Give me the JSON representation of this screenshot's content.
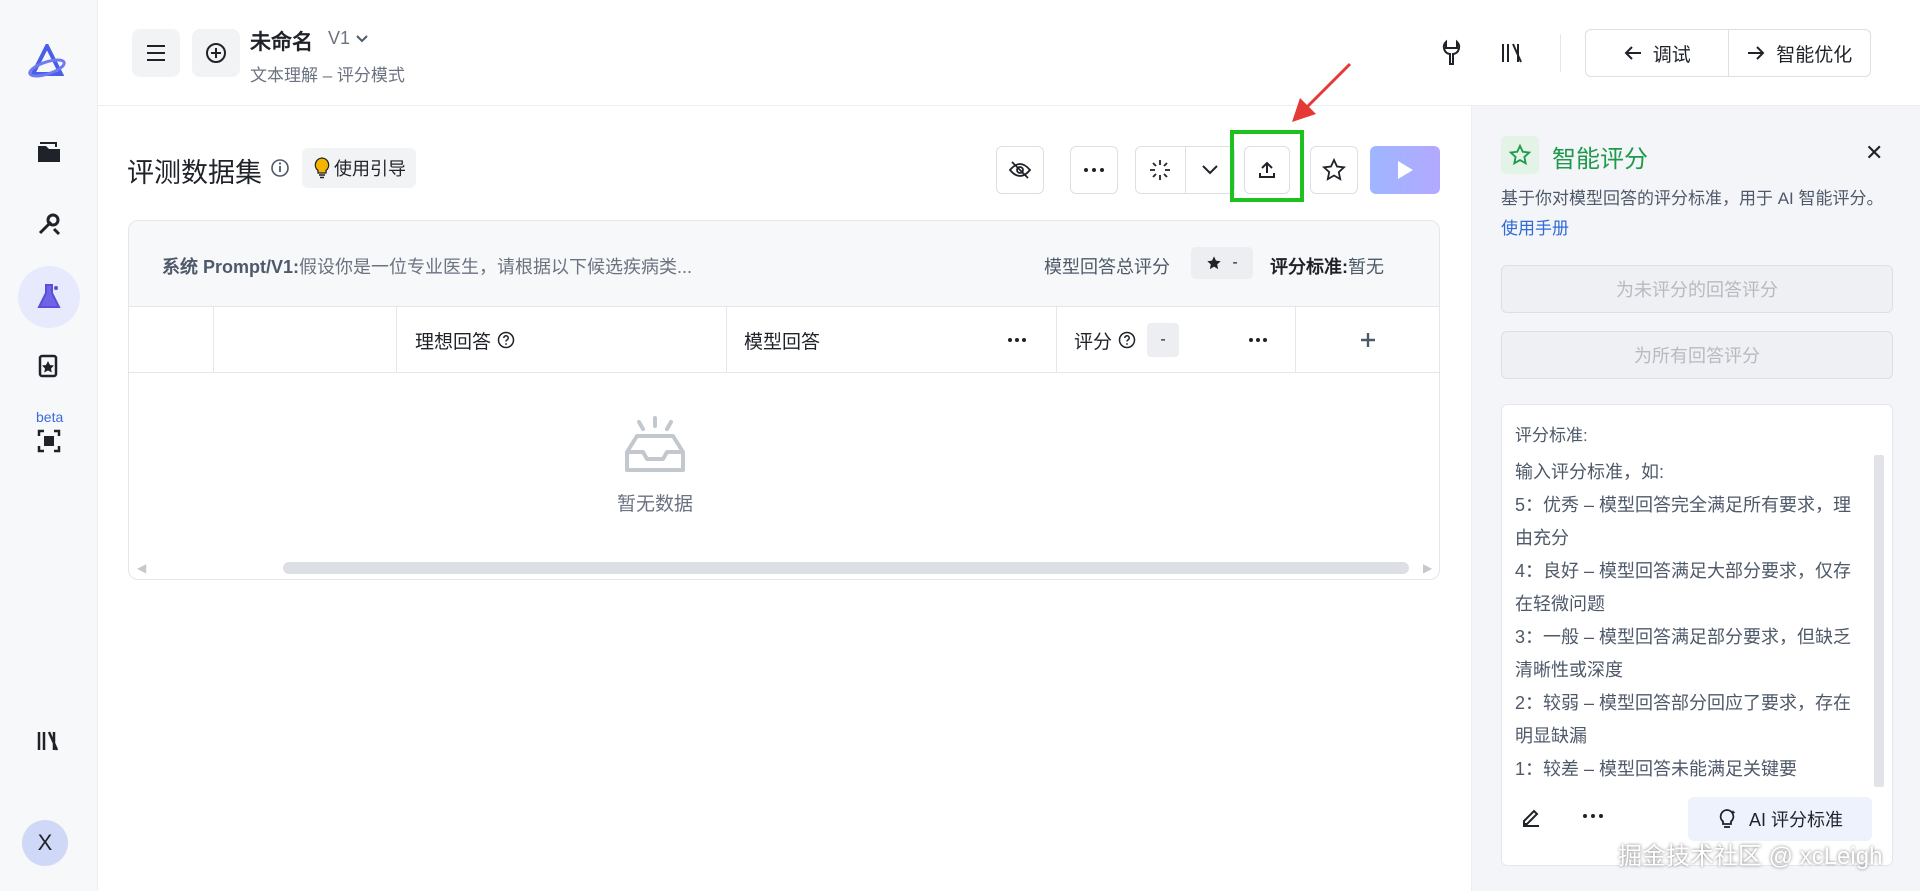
{
  "header": {
    "title": "未命名",
    "version": "V1",
    "subtitle": "文本理解 – 评分模式",
    "nav_debug": "调试",
    "nav_optimize": "智能优化"
  },
  "rail": {
    "beta_label": "beta",
    "avatar_initial": "X"
  },
  "main": {
    "title": "评测数据集",
    "guide_label": "使用引导",
    "system_prompt_key": "系统 Prompt/V1:",
    "system_prompt_value": "假设你是一位专业医生，请根据以下候选疾病类...",
    "total_rating_label": "模型回答总评分",
    "total_rating_value": "-",
    "criteria_key": "评分标准:",
    "criteria_value": "暂无",
    "columns": {
      "ideal": "理想回答",
      "model": "模型回答",
      "score": "评分",
      "score_value": "-"
    },
    "empty_text": "暂无数据"
  },
  "right_panel": {
    "title": "智能评分",
    "description": "基于你对模型回答的评分标准，用于 AI 智能评分。",
    "manual_link": "使用手册",
    "btn_unrated": "为未评分的回答评分",
    "btn_all": "为所有回答评分",
    "criteria_label": "评分标准:",
    "criteria_placeholder": "输入评分标准，如:\n5：优秀 – 模型回答完全满足所有要求，理由充分\n4：良好 – 模型回答满足大部分要求，仅存在轻微问题\n3：一般 – 模型回答满足部分要求，但缺乏清晰性或深度\n2：较弱 – 模型回答部分回应了要求，存在明显缺漏\n1：较差 – 模型回答未能满足关键要",
    "ai_btn": "AI 评分标准"
  },
  "watermark": "掘金技术社区 @ xcLeigh",
  "colors": {
    "highlight": "#1ec21e",
    "accent_green": "#1f9a4d",
    "link": "#2f6bd8",
    "arrow": "#e53935"
  }
}
